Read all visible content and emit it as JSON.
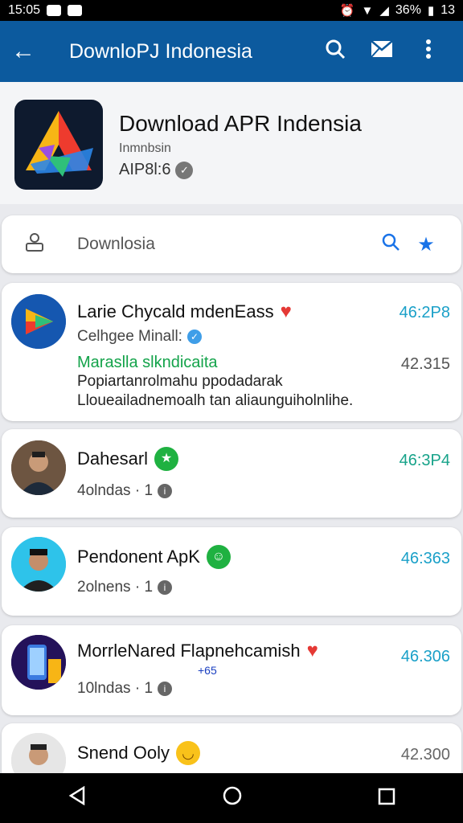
{
  "status_bar": {
    "time": "15:05",
    "battery": "36%",
    "signal": "13"
  },
  "app_bar": {
    "title": "DownloPJ Indonesia"
  },
  "header": {
    "title": "Download APR Indensia",
    "subtitle": "Inmnbsin",
    "line2": "AIP8l:6"
  },
  "search": {
    "label": "Downlosia"
  },
  "items": [
    {
      "title": "Larie Chycald mdenEass",
      "sub": "Celhgee Minall:",
      "value": "46:2P8",
      "value_color": "#1aa0c8",
      "green": "Maraslla slkndicaita",
      "value2": "42.315",
      "desc1": "Popiartanrolmahu ppodadarak",
      "desc2": "Lloueailadnemoalh tan aliaunguiholnlihe."
    },
    {
      "title": "Dahesarl",
      "sub": "4olndas · 1",
      "value": "46:3P4",
      "value_color": "#18a38a"
    },
    {
      "title": "Pendonent ApK",
      "sub": "2olnens · 1",
      "value": "46:363",
      "value_color": "#1aa0c8"
    },
    {
      "title": "MorrleNared Flapnehcamish",
      "sub": "10lndas · 1",
      "value": "46.306",
      "value_color": "#1aa0c8",
      "extra": "+65"
    },
    {
      "title": "Snend Ooly",
      "value": "42.300",
      "value_color": "#666"
    }
  ]
}
